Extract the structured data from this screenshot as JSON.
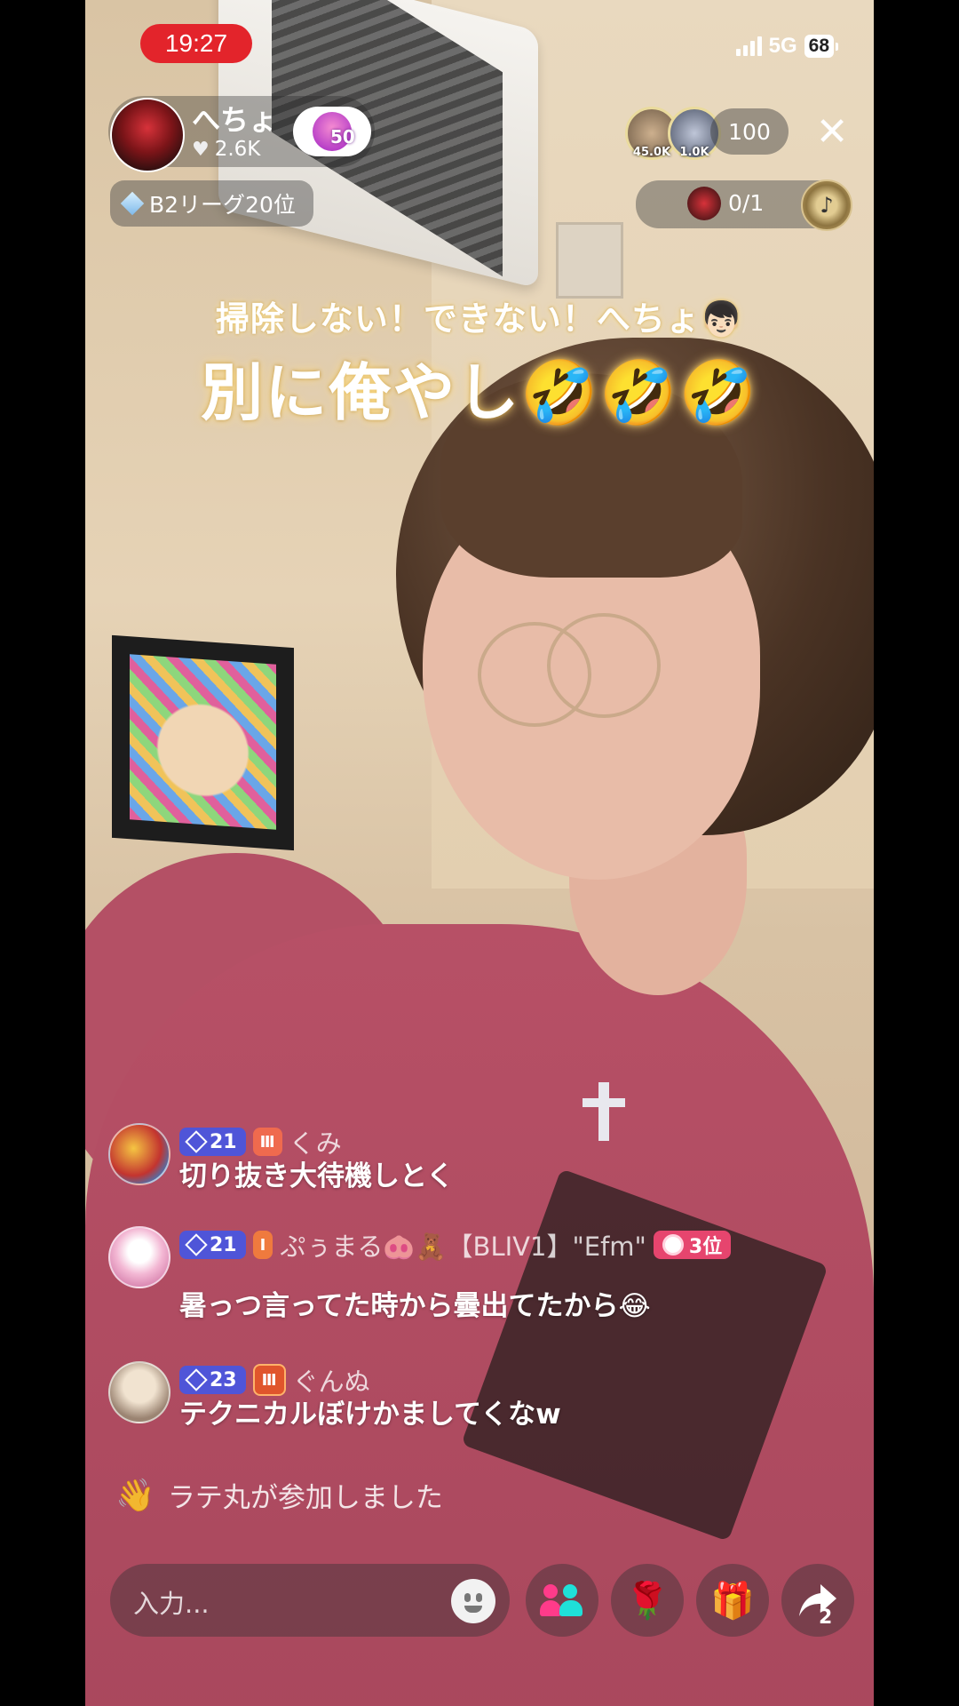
{
  "status_bar": {
    "time": "19:27",
    "network": "5G",
    "battery": "68"
  },
  "host": {
    "name": "へちょ",
    "likes": "2.6K",
    "level": "50",
    "rank": "B2リーグ20位"
  },
  "top_right": {
    "viewer1_score": "45.0K",
    "viewer2_score": "1.0K",
    "viewer_count": "100",
    "goal_progress": "0/1",
    "close_icon": "close-icon"
  },
  "captions": {
    "line1": "掃除しない！できない！へちょ👦🏻",
    "line2": "別に俺やし🤣🤣🤣"
  },
  "comments": [
    {
      "level": "21",
      "name": "くみ",
      "text": "切り抜き大待機しとく"
    },
    {
      "level": "21",
      "name": "ぷぅまる🐽🧸【BLIV1】\"Efm\"",
      "rank": "3位",
      "text": "暑っつ言ってた時から曇出てたから😂"
    },
    {
      "level": "23",
      "name": "ぐんぬ",
      "text": "テクニカルぼけかましてくなw"
    }
  ],
  "join_message": "ラテ丸が参加しました",
  "bottom_bar": {
    "input_placeholder": "入力...",
    "share_count": "2"
  },
  "colors": {
    "time_pill": "#e3242b",
    "level_badge": "#4f55d8",
    "rank_tag": "#e6456e"
  }
}
